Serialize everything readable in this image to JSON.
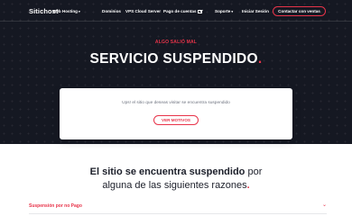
{
  "header": {
    "logo": "Sitichost",
    "nav": [
      {
        "label": "Web Hosting",
        "dropdown": true
      },
      {
        "label": "Dominios",
        "dropdown": false
      },
      {
        "label": "VPS Cloud Server",
        "dropdown": false
      },
      {
        "label": "Pago de cuentas",
        "icon": "mail-icon"
      },
      {
        "label": "Soporte",
        "dropdown": true
      },
      {
        "label": "Iniciar Sesión",
        "dropdown": false
      }
    ],
    "contact_button": "Contactar con ventas"
  },
  "hero": {
    "eyebrow": "ALGO SALIÓ MAL",
    "title_bold": "SERVICIO",
    "title_rest": "SUSPENDIDO",
    "title_dot": "."
  },
  "card": {
    "message": "Ups! el sitio que deseas visitar se encuentra suspendido",
    "button": "VER MOTIVOS"
  },
  "reasons": {
    "line1_bold": "El sitio se encuentra suspendido",
    "line1_rest": "por",
    "line2": "alguna de las siguientes razones",
    "dot": "."
  },
  "accordion": {
    "items": [
      {
        "label": "Suspensión por no Pago",
        "icon": "chevron-down-icon"
      }
    ]
  },
  "colors": {
    "accent": "#e8344a",
    "hero_bg": "#151822",
    "text_dark": "#1c1f2a"
  }
}
